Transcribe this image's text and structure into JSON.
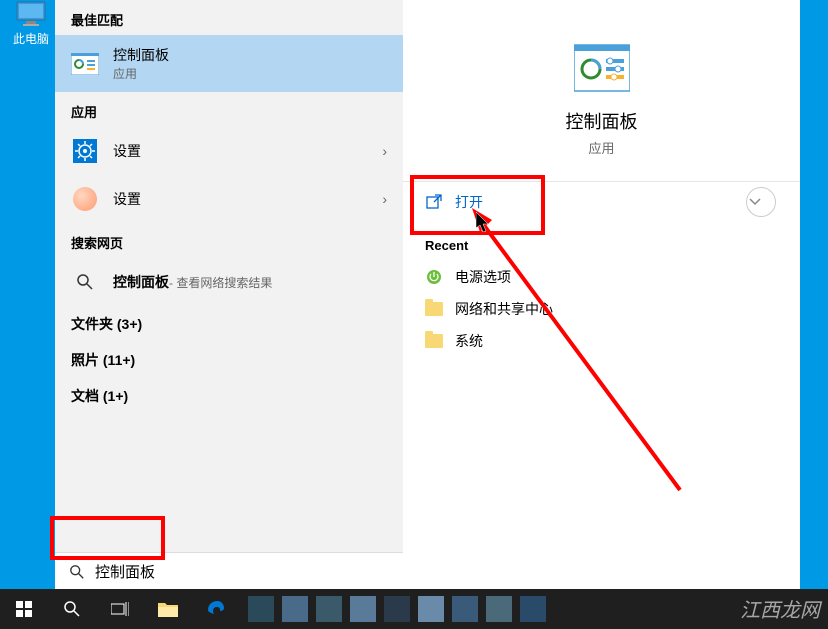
{
  "desktop": {
    "this_pc_label": "此电脑"
  },
  "left": {
    "best_match": "最佳匹配",
    "best_item": {
      "title": "控制面板",
      "sub": "应用"
    },
    "apps_header": "应用",
    "app_items": [
      {
        "title": "设置"
      },
      {
        "title": "设置"
      }
    ],
    "web_header": "搜索网页",
    "web_item": {
      "title": "控制面板",
      "suffix": " - 查看网络搜索结果"
    },
    "categories": [
      "文件夹 (3+)",
      "照片 (11+)",
      "文档 (1+)"
    ]
  },
  "preview": {
    "title": "控制面板",
    "sub": "应用",
    "open_label": "打开",
    "recent_header": "Recent",
    "recent": [
      "电源选项",
      "网络和共享中心",
      "系统"
    ]
  },
  "search": {
    "value": "控制面板"
  },
  "watermark": "江西龙网"
}
